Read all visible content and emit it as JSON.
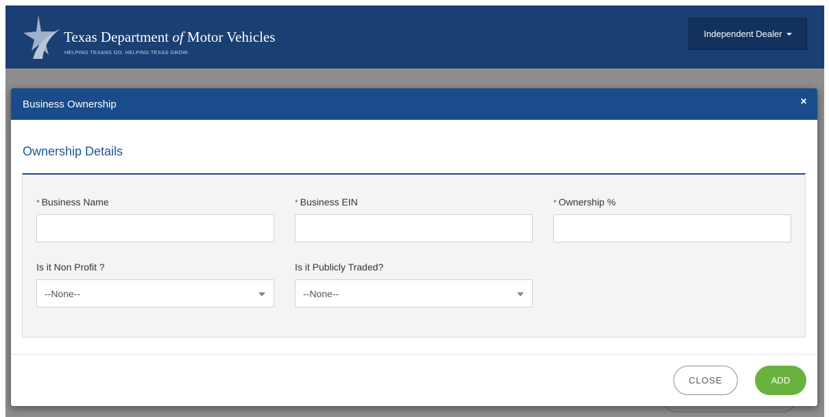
{
  "header": {
    "brand_title_part1": "Texas Department ",
    "brand_title_of": "of",
    "brand_title_part2": " Motor Vehicles",
    "brand_tagline": "HELPING TEXANS GO. HELPING TEXAS GROW.",
    "dealer_label": "Independent Dealer"
  },
  "modal": {
    "title": "Business Ownership",
    "close_glyph": "×",
    "section_title": "Ownership Details",
    "fields": {
      "business_name": {
        "required_mark": "*",
        "label": "Business Name",
        "value": ""
      },
      "business_ein": {
        "required_mark": "*",
        "label": "Business EIN",
        "value": ""
      },
      "ownership_pct": {
        "required_mark": "*",
        "label": "Ownership %",
        "value": ""
      },
      "non_profit": {
        "label": "Is it Non Profit ?",
        "selected": "--None--"
      },
      "publicly_traded": {
        "label": "Is it Publicly Traded?",
        "selected": "--None--"
      }
    },
    "buttons": {
      "close": "CLOSE",
      "add": "ADD"
    }
  },
  "colors": {
    "header_bg": "#1a3f72",
    "modal_header_bg": "#1a4b8a",
    "section_title": "#1e5593",
    "add_button": "#6ab23e",
    "required": "#c0392b"
  }
}
